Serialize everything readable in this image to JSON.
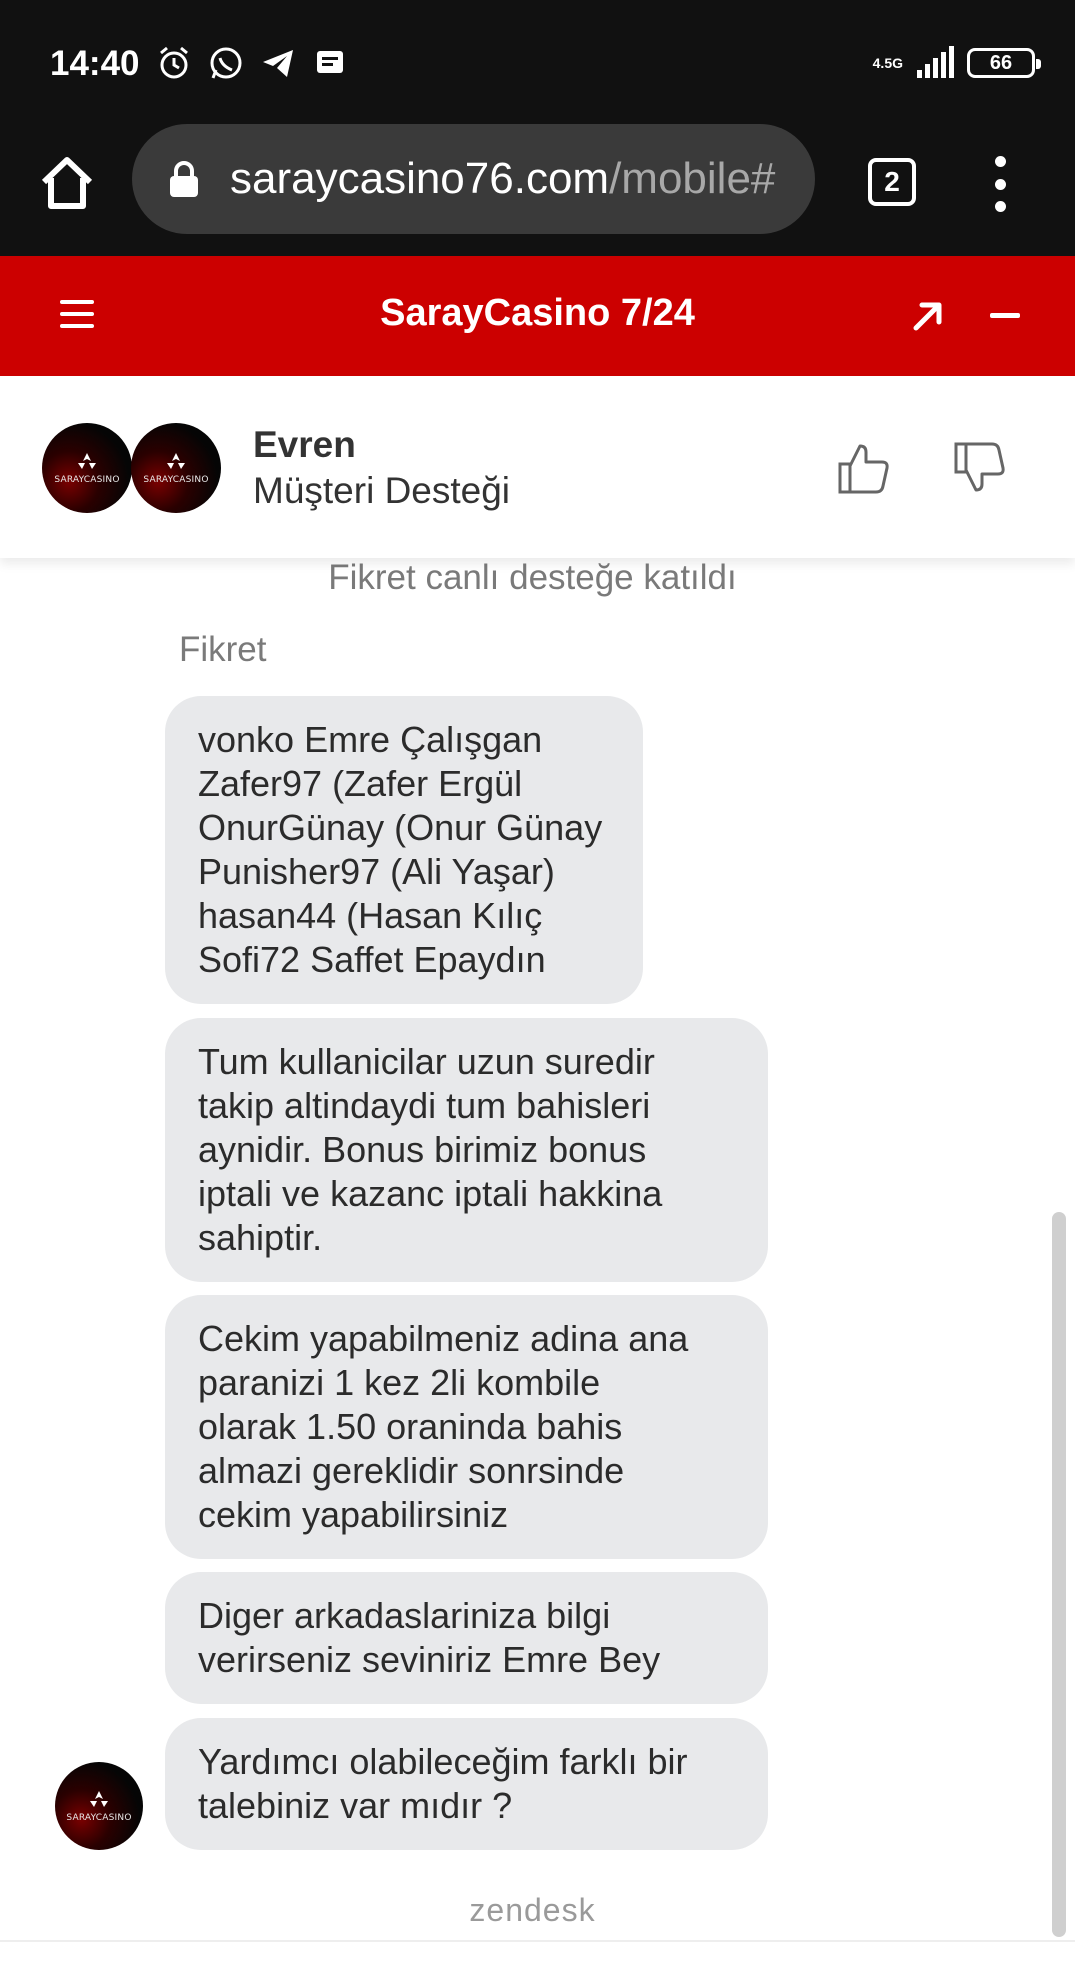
{
  "status_bar": {
    "time": "14:40",
    "icons": [
      "alarm-icon",
      "whatsapp-icon",
      "telegram-icon",
      "message-icon"
    ],
    "network": "4.5G",
    "battery": "66"
  },
  "browser": {
    "url_domain": "saraycasino76.com",
    "url_path": "/mobile#",
    "tab_count": "2"
  },
  "chat_header": {
    "title": "SarayCasino 7/24"
  },
  "agent": {
    "name": "Evren",
    "role": "Müşteri Desteği",
    "avatar_text": "SARAYCASINO"
  },
  "conversation": {
    "system_message": "Fikret canlı desteğe katıldı",
    "sender": "Fikret",
    "messages": [
      "vonko Emre Çalışgan\nZafer97 (Zafer Ergül\nOnurGünay (Onur Günay\nPunisher97 (Ali Yaşar)\nhasan44 (Hasan Kılıç\nSofi72 Saffet Epaydın",
      "Tum kullanicilar uzun suredir\ntakip altindaydi tum bahisleri\naynidir. Bonus birimiz bonus\niptali ve kazanc iptali hakkina\nsahiptir.",
      "Cekim yapabilmeniz adina ana\nparanizi 1 kez 2li kombile\nolarak 1.50 oraninda bahis\nalmazi gereklidir sonrsinde\ncekim yapabilirsiniz",
      "Diger arkadaslariniza bilgi\nverirseniz seviniriz Emre Bey",
      "Yardımcı olabileceğim farklı bir\ntalebiniz var mıdır ?"
    ]
  },
  "footer": {
    "brand": "zendesk"
  },
  "colors": {
    "header_red": "#cc0000",
    "bubble_gray": "#e8e9eb",
    "status_black": "#111111"
  }
}
